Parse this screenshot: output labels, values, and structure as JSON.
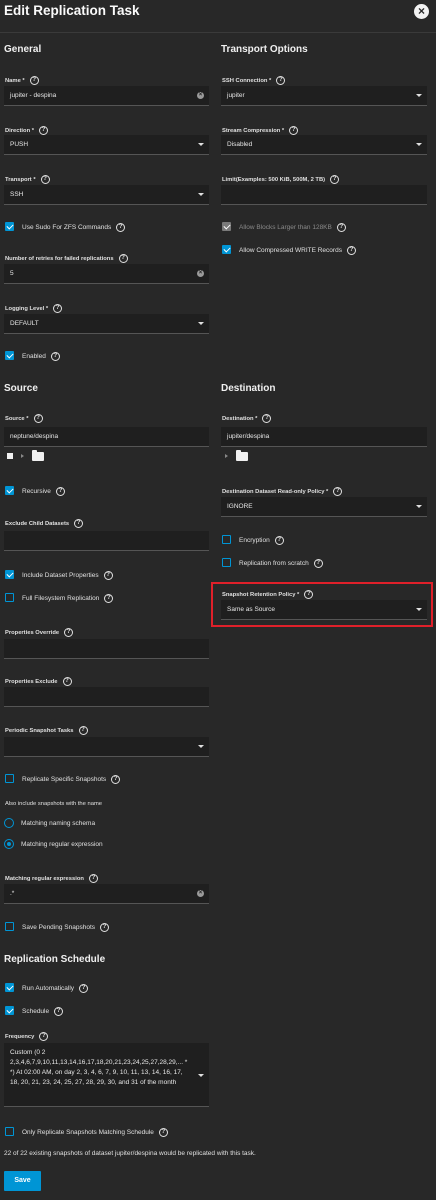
{
  "header": {
    "title": "Edit Replication Task",
    "close_icon": "×"
  },
  "general": {
    "title": "General",
    "name_label": "Name *",
    "name_value": "jupiter - despina",
    "direction_label": "Direction *",
    "direction_value": "PUSH",
    "transport_label": "Transport *",
    "transport_value": "SSH",
    "sudo_label": "Use Sudo For ZFS Commands",
    "retries_label": "Number of retries for failed replications",
    "retries_value": "5",
    "logging_label": "Logging Level *",
    "logging_value": "DEFAULT",
    "enabled_label": "Enabled"
  },
  "transport": {
    "title": "Transport Options",
    "ssh_label": "SSH Connection *",
    "ssh_value": "jupiter",
    "compression_label": "Stream Compression *",
    "compression_value": "Disabled",
    "limit_label": "Limit(Examples: 500 KiB, 500M, 2 TB)",
    "limit_value": "",
    "large_blocks_label": "Allow Blocks Larger than 128KB",
    "compressed_label": "Allow Compressed WRITE Records"
  },
  "source": {
    "title": "Source",
    "source_label": "Source *",
    "source_value": "neptune/despina",
    "recursive_label": "Recursive",
    "exclude_label": "Exclude Child Datasets",
    "exclude_value": "",
    "include_props_label": "Include Dataset Properties",
    "full_fs_label": "Full Filesystem Replication",
    "props_override_label": "Properties Override",
    "props_override_value": "",
    "props_exclude_label": "Properties Exclude",
    "props_exclude_value": "",
    "periodic_label": "Periodic Snapshot Tasks",
    "periodic_value": "",
    "specific_snapshots_label": "Replicate Specific Snapshots",
    "also_include_label": "Also include snapshots with the name",
    "naming_schema_label": "Matching naming schema",
    "regex_radio_label": "Matching regular expression",
    "regex_label": "Matching regular expression",
    "regex_value": ".*",
    "save_pending_label": "Save Pending Snapshots"
  },
  "destination": {
    "title": "Destination",
    "dest_label": "Destination *",
    "dest_value": "jupiter/despina",
    "readonly_label": "Destination Dataset Read-only Policy *",
    "readonly_value": "IGNORE",
    "encryption_label": "Encryption",
    "from_scratch_label": "Replication from scratch",
    "retention_label": "Snapshot Retention Policy *",
    "retention_value": "Same as Source"
  },
  "schedule": {
    "title": "Replication Schedule",
    "run_auto_label": "Run Automatically",
    "schedule_label": "Schedule",
    "frequency_label": "Frequency",
    "frequency_value": "Custom (0 2 2,3,4,6,7,9,10,11,13,14,16,17,18,20,21,23,24,25,27,28,29,... * *) At 02:00 AM, on day 2, 3, 4, 6, 7, 9, 10, 11, 13, 14, 16, 17, 18, 20, 21, 23, 24, 25, 27, 28, 29, 30, and 31 of the month",
    "only_matching_label": "Only Replicate Snapshots Matching Schedule"
  },
  "footer": {
    "info": "22 of 22 existing snapshots of dataset jupiter/despina would be replicated with this task.",
    "save_label": "Save"
  },
  "colors": {
    "accent": "#0095d5",
    "background": "#282828",
    "highlight": "#e0202a"
  }
}
